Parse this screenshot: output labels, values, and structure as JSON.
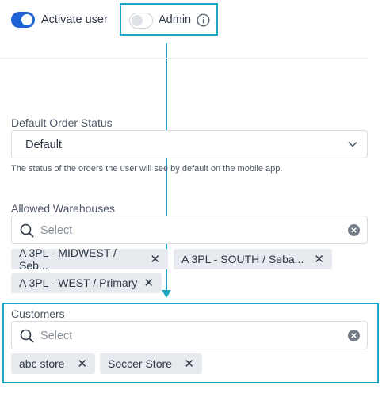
{
  "activate_user": {
    "label": "Activate user",
    "checked": true
  },
  "admin": {
    "label": "Admin",
    "checked": false
  },
  "icons": {
    "info": "info-icon",
    "chevron": "chevron-down-icon",
    "search": "search-icon",
    "clear": "clear-circle-icon",
    "remove": "close-icon"
  },
  "default_order_status": {
    "label": "Default Order Status",
    "value": "Default",
    "help": "The status of the orders the user will see by default on the mobile app."
  },
  "allowed_warehouses": {
    "label": "Allowed Warehouses",
    "placeholder": "Select",
    "chips": [
      {
        "label": "A 3PL - MIDWEST / Seb...",
        "remove": "✕"
      },
      {
        "label": "A 3PL - SOUTH / Seba...",
        "remove": "✕"
      },
      {
        "label": "A 3PL - WEST / Primary",
        "remove": "✕"
      }
    ]
  },
  "customers": {
    "label": "Customers",
    "placeholder": "Select",
    "chips": [
      {
        "label": "abc store",
        "remove": "✕"
      },
      {
        "label": "Soccer Store",
        "remove": "✕"
      }
    ]
  },
  "colors": {
    "accent": "#1e63d5",
    "highlight": "#1ea7c4",
    "chip_bg": "#e7eaee"
  }
}
